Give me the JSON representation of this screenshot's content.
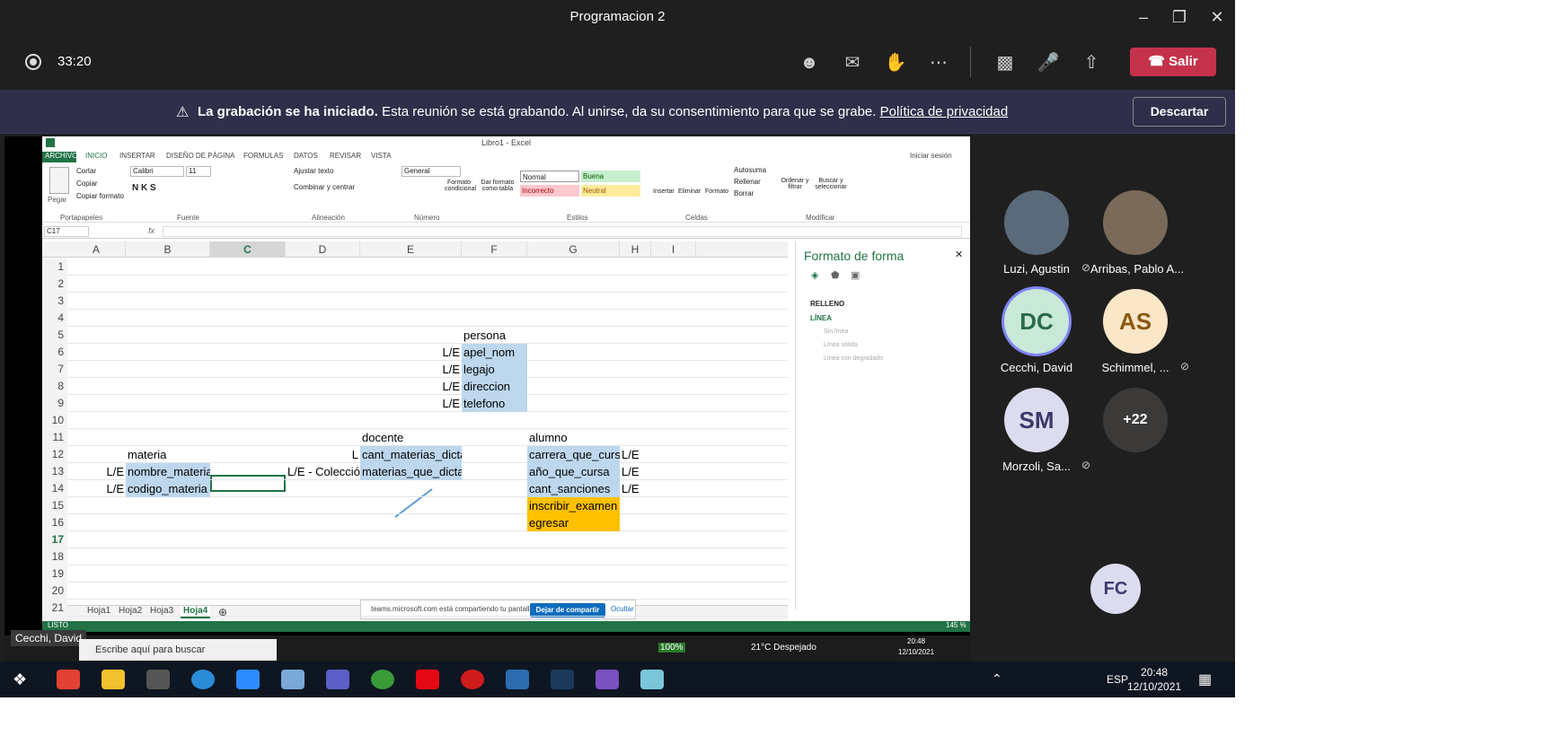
{
  "window": {
    "title": "Programacion 2"
  },
  "toolbar": {
    "timer": "33:20",
    "leave_label": "Salir"
  },
  "banner": {
    "bold": "La grabación se ha iniciado.",
    "text": "Esta reunión se está grabando. Al unirse, da su consentimiento para que se grabe.",
    "link": "Política de privacidad",
    "dismiss": "Descartar"
  },
  "excel": {
    "title": "Libro1 - Excel",
    "tabs": [
      "ARCHIVO",
      "INICIO",
      "INSERTAR",
      "DISEÑO DE PÁGINA",
      "FORMULAS",
      "DATOS",
      "REVISAR",
      "VISTA"
    ],
    "signin": "Iniciar sesión",
    "clipboard": {
      "paste": "Pegar",
      "cut": "Cortar",
      "copy": "Copiar",
      "format_painter": "Copiar formato"
    },
    "font": {
      "name": "Calibri",
      "size": "11"
    },
    "alignment": {
      "wrap": "Ajustar texto",
      "merge": "Combinar y centrar"
    },
    "number_format": "General",
    "styles": {
      "normal": "Normal",
      "good": "Buena",
      "bad": "Incorrecto",
      "neutral": "Neutral"
    },
    "style_buttons": [
      "Formato condicional",
      "Dar formato como tabla"
    ],
    "cells_buttons": [
      "Insertar",
      "Eliminar",
      "Formato"
    ],
    "editing": {
      "autosum": "Autosuma",
      "fill": "Rellenar",
      "clear": "Borrar",
      "sort": "Ordenar y filtrar",
      "find": "Buscar y seleccionar"
    },
    "groups": [
      "Portapapeles",
      "Fuente",
      "Alineación",
      "Número",
      "Estilos",
      "Celdas",
      "Modificar"
    ],
    "namebox": "C17",
    "fx": "fx",
    "columns": [
      "A",
      "B",
      "C",
      "D",
      "E",
      "F",
      "G",
      "H",
      "I"
    ],
    "rows": [
      "1",
      "2",
      "3",
      "4",
      "5",
      "6",
      "7",
      "8",
      "9",
      "10",
      "11",
      "12",
      "13",
      "14",
      "15",
      "16",
      "17",
      "18",
      "19",
      "20",
      "21"
    ],
    "cells": {
      "F5": "persona",
      "E6": "L/E",
      "F6": "apel_nom",
      "E7": "L/E",
      "F7": "legajo",
      "E8": "L/E",
      "F8": "direccion",
      "E9": "L/E",
      "F9": "telefono",
      "E11": "docente",
      "G11": "alumno",
      "B12": "materia",
      "D12": "L",
      "E12": "cant_materias_dicta",
      "G12": "carrera_que_cursa",
      "H12": "L/E",
      "A13": "L/E",
      "B13": "nombre_materia",
      "D13": "L/E - Colección",
      "E13": "materias_que_dicta",
      "G13": "año_que_cursa",
      "H13": "L/E",
      "A14": "L/E",
      "B14": "codigo_materia",
      "G14": "cant_sanciones",
      "H14": "L/E",
      "G15": "inscribir_examen",
      "G16": "egresar"
    },
    "sheets": [
      "Hoja1",
      "Hoja2",
      "Hoja3",
      "Hoja4"
    ],
    "active_sheet": "Hoja4",
    "share_msg": "teams.microsoft.com está compartiendo tu pantalla.",
    "stop_share": "Dejar de compartir",
    "hide": "Ocultar",
    "pane": {
      "title": "Formato de forma",
      "fill": "RELLENO",
      "line": "LÍNEA",
      "opts": [
        "Sin línea",
        "Línea sólida",
        "Línea con degradado"
      ]
    },
    "zoom": "145 %",
    "status_left": "LISTO"
  },
  "inner_taskbar": {
    "presenter": "Cecchi, David",
    "search": "Escribe aquí para buscar",
    "battery": "100%",
    "weather": "21°C Despejado",
    "time": "20:48",
    "date": "12/10/2021"
  },
  "participants": [
    {
      "name": "Luzi, Agustin",
      "muted": true,
      "initials": "",
      "color": "#5a6a7a"
    },
    {
      "name": "Arribas, Pablo A...",
      "muted": false,
      "initials": "",
      "color": "#7a6a5a"
    },
    {
      "name": "Cecchi, David",
      "muted": false,
      "initials": "DC",
      "color": "#c8e8d8"
    },
    {
      "name": "Schimmel, ...",
      "muted": true,
      "initials": "AS",
      "color": "#fbe6c8"
    },
    {
      "name": "Morzoli, Sa...",
      "muted": true,
      "initials": "SM",
      "color": "#dcdcf0"
    },
    {
      "name": "",
      "muted": false,
      "initials": "+22",
      "color": "#3b3a39"
    }
  ],
  "fc": "FC",
  "taskbar": {
    "lang": "ESP",
    "time": "20:48",
    "date": "12/10/2021"
  }
}
